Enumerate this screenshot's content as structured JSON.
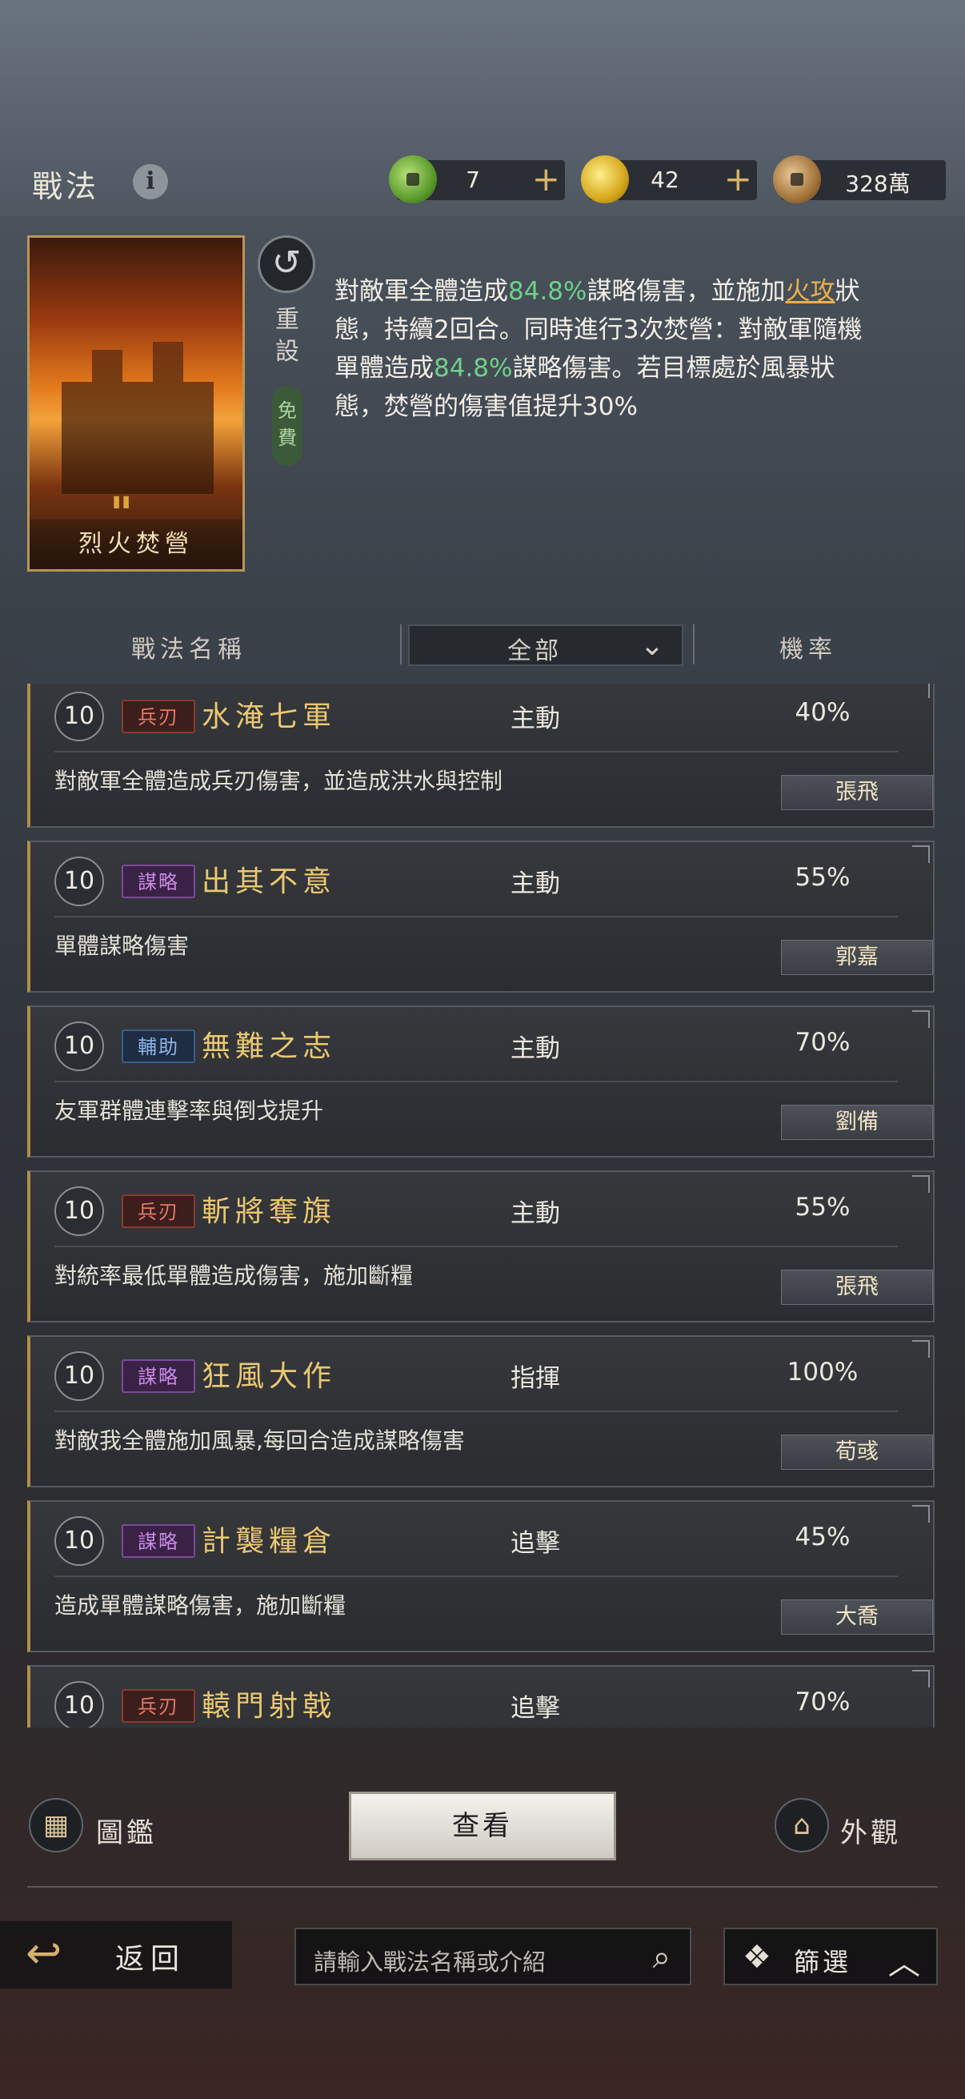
{
  "header": {
    "title": "戰法",
    "info_icon": "i",
    "resources": [
      {
        "icon": "jade-coin-icon",
        "value": "7",
        "plus": "+"
      },
      {
        "icon": "gold-coin-icon",
        "value": "42",
        "plus": "+"
      },
      {
        "icon": "copper-coin-icon",
        "value": "328萬"
      }
    ]
  },
  "detail": {
    "card_name": "烈火焚營",
    "reset_label": "重設",
    "free_label": "免費",
    "desc": {
      "p1": "對敵軍全體造成",
      "v1": "84.8%",
      "p2": "謀略傷害，並施加",
      "fire": "火攻",
      "p3": "狀態，持續2回合。同時進行3次焚營：對敵軍隨機單體造成",
      "v2": "84.8%",
      "p4": "謀略傷害。若目標處於風暴狀態，焚營的傷害值提升30%"
    }
  },
  "table_header": {
    "name_col": "戰法名稱",
    "filter_value": "全部",
    "rate_col": "機率"
  },
  "skills": [
    {
      "level": "10",
      "type": "兵刃",
      "type_class": "bingren",
      "name": "水淹七軍",
      "kind": "主動",
      "rate": "40%",
      "desc": "對敵軍全體造成兵刃傷害，並造成洪水與控制",
      "hero": "張飛"
    },
    {
      "level": "10",
      "type": "謀略",
      "type_class": "moulue",
      "name": "出其不意",
      "kind": "主動",
      "rate": "55%",
      "desc": "單體謀略傷害",
      "hero": "郭嘉"
    },
    {
      "level": "10",
      "type": "輔助",
      "type_class": "fuzhu",
      "name": "無難之志",
      "kind": "主動",
      "rate": "70%",
      "desc": "友軍群體連擊率與倒戈提升",
      "hero": "劉備"
    },
    {
      "level": "10",
      "type": "兵刃",
      "type_class": "bingren",
      "name": "斬將奪旗",
      "kind": "主動",
      "rate": "55%",
      "desc": "對統率最低單體造成傷害，施加斷糧",
      "hero": "張飛"
    },
    {
      "level": "10",
      "type": "謀略",
      "type_class": "moulue",
      "name": "狂風大作",
      "kind": "指揮",
      "rate": "100%",
      "desc": "對敵我全體施加風暴,每回合造成謀略傷害",
      "hero": "荀彧"
    },
    {
      "level": "10",
      "type": "謀略",
      "type_class": "moulue",
      "name": "計襲糧倉",
      "kind": "追擊",
      "rate": "45%",
      "desc": "造成單體謀略傷害，施加斷糧",
      "hero": "大喬"
    },
    {
      "level": "10",
      "type": "兵刃",
      "type_class": "bingren",
      "name": "轅門射戟",
      "kind": "追擊",
      "rate": "70%",
      "desc": "",
      "hero": ""
    }
  ],
  "actions": {
    "catalog_label": "圖鑑",
    "view_label": "查看",
    "appearance_label": "外觀"
  },
  "bottom": {
    "back_label": "返回",
    "search_placeholder": "請輸入戰法名稱或介紹",
    "filter_label": "篩選"
  }
}
